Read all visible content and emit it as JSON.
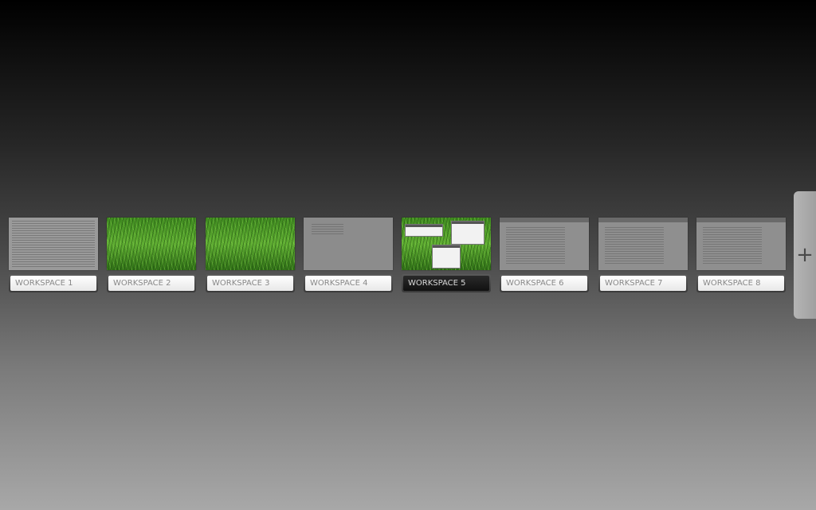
{
  "workspaces": [
    {
      "label": "WORKSPACE 1",
      "thumbnail": "terminal-text",
      "active": false
    },
    {
      "label": "WORKSPACE 2",
      "thumbnail": "grass-wallpaper",
      "active": false
    },
    {
      "label": "WORKSPACE 3",
      "thumbnail": "grass-wallpaper",
      "active": false
    },
    {
      "label": "WORKSPACE 4",
      "thumbnail": "mostly-empty",
      "active": false
    },
    {
      "label": "WORKSPACE 5",
      "thumbnail": "grass-with-windows",
      "active": true
    },
    {
      "label": "WORKSPACE 6",
      "thumbnail": "application-window",
      "active": false
    },
    {
      "label": "WORKSPACE 7",
      "thumbnail": "application-window",
      "active": false
    },
    {
      "label": "WORKSPACE 8",
      "thumbnail": "application-window",
      "active": false
    }
  ],
  "add_workspace": {
    "icon": "plus-icon",
    "glyph": "+"
  },
  "colors": {
    "active_label_bg": "#1a1a1a",
    "inactive_label_bg": "#f2f2f2",
    "label_text": "#888888"
  }
}
